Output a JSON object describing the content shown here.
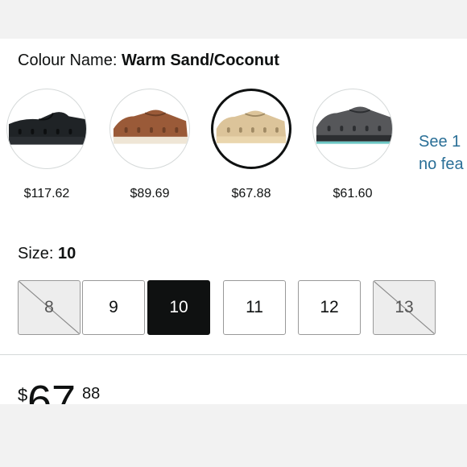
{
  "colour": {
    "label": "Colour Name: ",
    "value": "Warm Sand/Coconut"
  },
  "swatches": [
    {
      "price": "$117.62",
      "upper": "#1f2326",
      "sole": "#2b2f33",
      "accent": "#0d0f10"
    },
    {
      "price": "$89.69",
      "upper": "#9a5a38",
      "sole": "#efe6d6",
      "accent": "#6e3f26"
    },
    {
      "price": "$67.88",
      "upper": "#dcc49a",
      "sole": "#ead6ae",
      "accent": "#a08a64"
    },
    {
      "price": "$61.60",
      "upper": "#56575a",
      "sole": "#2c2e31",
      "accent": "#6cc7c4"
    }
  ],
  "see_more": {
    "line1": "See 1",
    "line2": "no fea"
  },
  "size": {
    "label": "Size: ",
    "value": "10",
    "options": [
      {
        "label": "8",
        "state": "unavailable"
      },
      {
        "label": "9",
        "state": "available"
      },
      {
        "label": "10",
        "state": "selected"
      },
      {
        "label": "11",
        "state": "available"
      },
      {
        "label": "12",
        "state": "available"
      },
      {
        "label": "13",
        "state": "unavailable"
      }
    ]
  },
  "price": {
    "symbol": "$",
    "whole": "67",
    "fraction": "88"
  }
}
